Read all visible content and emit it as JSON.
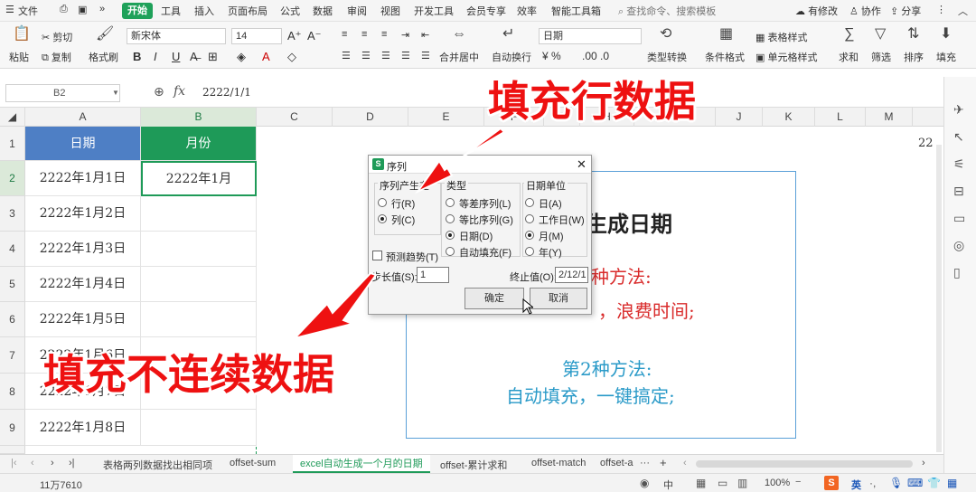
{
  "menubar": {
    "file": "文件",
    "tabs": [
      "开始",
      "工具",
      "插入",
      "页面布局",
      "公式",
      "数据",
      "审阅",
      "视图",
      "开发工具",
      "会员专享",
      "效率",
      "智能工具箱"
    ],
    "search_placeholder": "查找命令、搜索模板",
    "right": [
      "有修改",
      "协作",
      "分享"
    ]
  },
  "ribbon": {
    "cut": "剪切",
    "paste": "粘贴",
    "copy": "复制",
    "format_painter": "格式刷",
    "font_name": "新宋体",
    "font_size": "14",
    "merge": "合并居中",
    "wrap": "自动换行",
    "number_format": "日期",
    "type_convert": "类型转换",
    "cond_format": "条件格式",
    "table_style": "表格样式",
    "cell_style": "单元格样式",
    "sum": "求和",
    "filter": "筛选",
    "sort": "排序",
    "fill": "填充"
  },
  "formulabar": {
    "cell_ref": "B2",
    "fx": "fx",
    "formula": "2222/1/1"
  },
  "grid": {
    "columns": [
      "A",
      "B",
      "C",
      "D",
      "E",
      "F",
      "G",
      "H",
      "I",
      "J",
      "K",
      "L",
      "M"
    ],
    "rows": [
      "1",
      "2",
      "3",
      "4",
      "5",
      "6",
      "7",
      "8",
      "9"
    ],
    "header_a": "日期",
    "header_b": "月份",
    "col_a": [
      "2222年1月1日",
      "2222年1月2日",
      "2222年1月3日",
      "2222年1月4日",
      "2222年1月5日",
      "2222年1月6日",
      "2222年1月7日",
      "2222年1月8日"
    ],
    "b2": "2222年1月",
    "m1_partial": "22",
    "colors": {
      "header_a": "#4e7fc5",
      "header_b": "#1e9a58"
    }
  },
  "dialog": {
    "title": "序列",
    "group_series": "序列产生在",
    "row": "行(R)",
    "column": "列(C)",
    "group_type": "类型",
    "linear": "等差序列(L)",
    "growth": "等比序列(G)",
    "date": "日期(D)",
    "autofill": "自动填充(F)",
    "group_unit": "日期单位",
    "day": "日(A)",
    "weekday": "工作日(W)",
    "month": "月(M)",
    "year": "年(Y)",
    "trend": "预测趋势(T)",
    "step_label": "步长值(S):",
    "step_value": "1",
    "stop_label": "终止值(O):",
    "stop_value": "2/12/1",
    "ok": "确定",
    "cancel": "取消"
  },
  "textbox": {
    "title_partial": "生成日期",
    "method1_partial": "种方法:",
    "method1_desc_partial": "，浪费时间;",
    "method2_title": "第2种方法:",
    "method2_desc": "自动填充，一键搞定;"
  },
  "overlay": {
    "fill_row": "填充行数据",
    "fill_noncontinuous": "填充不连续数据"
  },
  "sheettabs": {
    "tabs": [
      "表格两列数据找出相同项",
      "offset-sum",
      "excel自动生成一个月的日期",
      "offset-累计求和",
      "offset-match",
      "offset-a"
    ],
    "active_color": "#1e9a58"
  },
  "statusbar": {
    "count": "11万7610",
    "zoom": "100%",
    "ime": "中",
    "ime2": "英"
  }
}
